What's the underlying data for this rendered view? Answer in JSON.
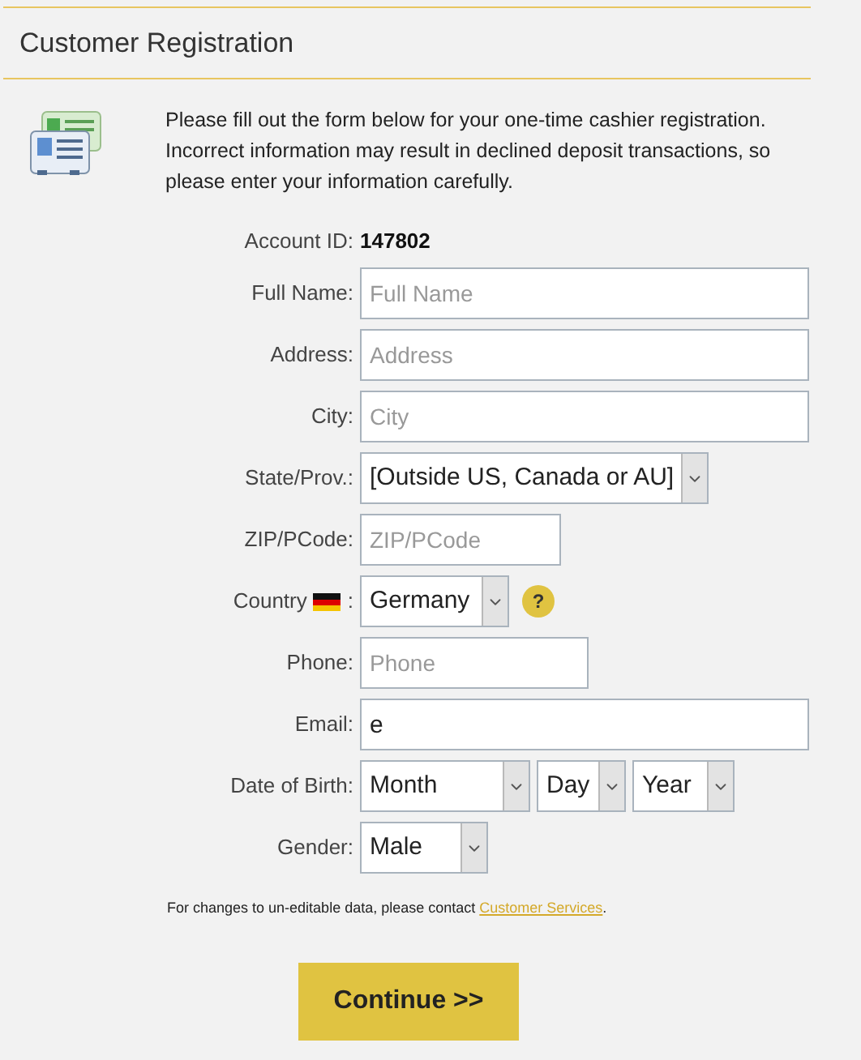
{
  "header": {
    "title": "Customer Registration"
  },
  "intro": "Please fill out the form below for your one-time cashier registration. Incorrect information may result in declined deposit transactions, so please enter your information carefully.",
  "fields": [
    {
      "kind": "static",
      "label": "Account ID:",
      "value": "147802"
    },
    {
      "kind": "text",
      "label": "Full Name:",
      "placeholder": "Full Name"
    },
    {
      "kind": "text",
      "label": "Address:",
      "placeholder": "Address"
    },
    {
      "kind": "text",
      "label": "City:",
      "placeholder": "City"
    },
    {
      "kind": "select",
      "label": "State/Prov.:",
      "value": "[Outside US, Canada or AU]"
    },
    {
      "kind": "text",
      "label": "ZIP/PCode:",
      "placeholder": "ZIP/PCode"
    },
    {
      "kind": "country",
      "label": "Country",
      "separator": ":",
      "value": "Germany",
      "help": "?"
    },
    {
      "kind": "text",
      "label": "Phone:",
      "placeholder": "Phone"
    },
    {
      "kind": "text",
      "label": "Email:",
      "value": "e"
    },
    {
      "kind": "date",
      "label": "Date of Birth:",
      "selects": [
        "Month",
        "Day",
        "Year"
      ]
    },
    {
      "kind": "select",
      "label": "Gender:",
      "value": "Male"
    }
  ],
  "note": {
    "text": "For changes to un-editable data, please contact ",
    "link": "Customer Services",
    "end": "."
  },
  "button": "Continue >>"
}
